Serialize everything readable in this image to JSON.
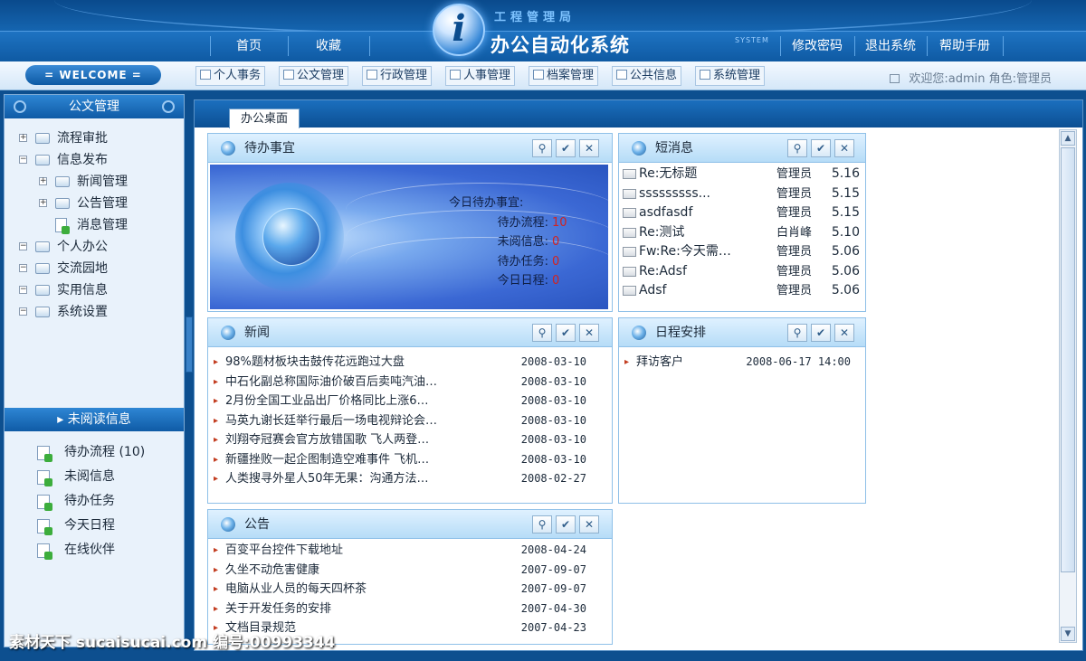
{
  "header": {
    "logo_subtitle": "工程管理局",
    "logo_title": "办公自动化系统",
    "system_tag": "SYSTEM",
    "nav_left": [
      "首页",
      "收藏"
    ],
    "nav_right": [
      "修改密码",
      "退出系统",
      "帮助手册"
    ]
  },
  "toolbar": {
    "welcome": "= WELCOME =",
    "modules": [
      "个人事务",
      "公文管理",
      "行政管理",
      "人事管理",
      "档案管理",
      "公共信息",
      "系统管理"
    ],
    "user_text": "欢迎您:admin  角色:管理员"
  },
  "sidebar": {
    "title": "公文管理",
    "tree": [
      {
        "label": "流程审批",
        "level": 0,
        "toggle": "+",
        "icon": "folder-icon"
      },
      {
        "label": "信息发布",
        "level": 0,
        "toggle": "−",
        "icon": "folder-icon"
      },
      {
        "label": "新闻管理",
        "level": 1,
        "toggle": "+",
        "icon": "folder-icon"
      },
      {
        "label": "公告管理",
        "level": 1,
        "toggle": "+",
        "icon": "folder-icon"
      },
      {
        "label": "消息管理",
        "level": 1,
        "toggle": "",
        "icon": "document-icon"
      },
      {
        "label": "个人办公",
        "level": 0,
        "toggle": "−",
        "icon": "folder-icon"
      },
      {
        "label": "交流园地",
        "level": 0,
        "toggle": "−",
        "icon": "folder-icon"
      },
      {
        "label": "实用信息",
        "level": 0,
        "toggle": "−",
        "icon": "folder-icon"
      },
      {
        "label": "系统设置",
        "level": 0,
        "toggle": "−",
        "icon": "folder-icon"
      }
    ],
    "unread_title": "未阅读信息",
    "unread_items": [
      "待办流程 (10)",
      "未阅信息",
      "待办任务",
      "今天日程",
      "在线伙伴"
    ]
  },
  "main": {
    "tab_label": "办公桌面",
    "todo": {
      "title": "待办事宜",
      "heading": "今日待办事宜:",
      "rows": [
        {
          "label": "待办流程:",
          "value": "10"
        },
        {
          "label": "未阅信息:",
          "value": "0"
        },
        {
          "label": "待办任务:",
          "value": "0"
        },
        {
          "label": "今日日程:",
          "value": "0"
        }
      ]
    },
    "messages": {
      "title": "短消息",
      "items": [
        {
          "subject": "Re:无标题",
          "sender": "管理员",
          "date": "5.16"
        },
        {
          "subject": "sssssssss...",
          "sender": "管理员",
          "date": "5.15"
        },
        {
          "subject": "asdfasdf",
          "sender": "管理员",
          "date": "5.15"
        },
        {
          "subject": "Re:测试",
          "sender": "白肖峰",
          "date": "5.10"
        },
        {
          "subject": "Fw:Re:今天需…",
          "sender": "管理员",
          "date": "5.06"
        },
        {
          "subject": "Re:Adsf",
          "sender": "管理员",
          "date": "5.06"
        },
        {
          "subject": "Adsf",
          "sender": "管理员",
          "date": "5.06"
        }
      ]
    },
    "news": {
      "title": "新闻",
      "items": [
        {
          "title": "98%题材板块击鼓传花远跑过大盘",
          "date": "2008-03-10"
        },
        {
          "title": "中石化副总称国际油价破百后卖吨汽油…",
          "date": "2008-03-10"
        },
        {
          "title": "2月份全国工业品出厂价格同比上涨6…",
          "date": "2008-03-10"
        },
        {
          "title": "马英九谢长廷举行最后一场电视辩论会…",
          "date": "2008-03-10"
        },
        {
          "title": "刘翔夺冠赛会官方放错国歌 飞人两登…",
          "date": "2008-03-10"
        },
        {
          "title": "新疆挫败一起企图制造空难事件 飞机…",
          "date": "2008-03-10"
        },
        {
          "title": "人类搜寻外星人50年无果：沟通方法…",
          "date": "2008-02-27"
        }
      ]
    },
    "schedule": {
      "title": "日程安排",
      "items": [
        {
          "title": "拜访客户",
          "date": "2008-06-17 14:00"
        }
      ]
    },
    "notice": {
      "title": "公告",
      "items": [
        {
          "title": "百变平台控件下载地址",
          "date": "2008-04-24"
        },
        {
          "title": "久坐不动危害健康",
          "date": "2007-09-07"
        },
        {
          "title": "电脑从业人员的每天四杯茶",
          "date": "2007-09-07"
        },
        {
          "title": "关于开发任务的安排",
          "date": "2007-04-30"
        },
        {
          "title": "文档目录规范",
          "date": "2007-04-23"
        }
      ]
    }
  },
  "watermark": "素材天下 sucaisucai.com  编号:00993344"
}
